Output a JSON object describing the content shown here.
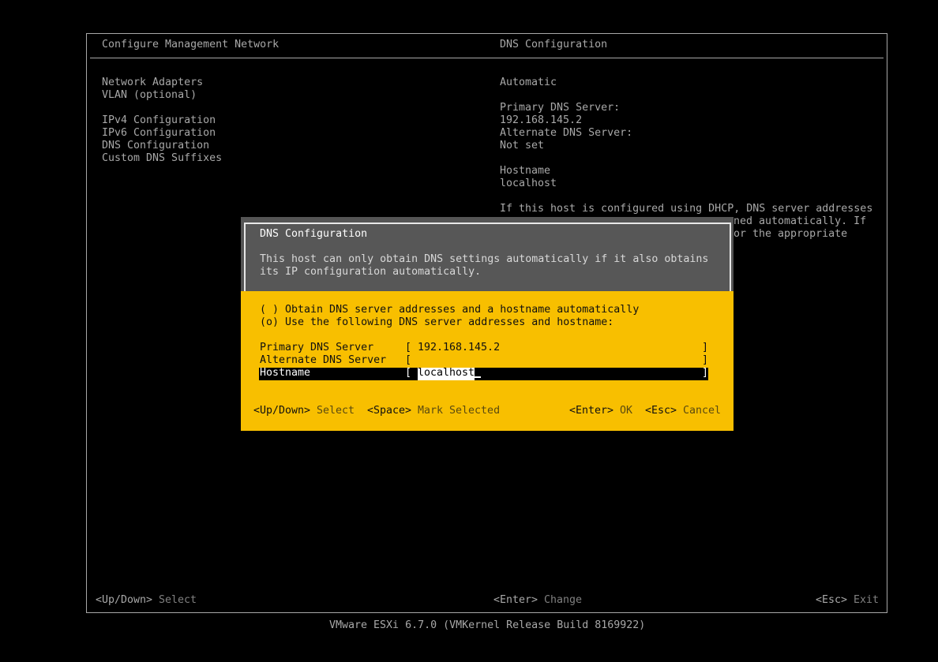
{
  "screen": {
    "title_left": "Configure Management Network",
    "title_right": "DNS Configuration"
  },
  "menu": {
    "items": [
      "Network Adapters",
      "VLAN (optional)",
      "IPv4 Configuration",
      "IPv6 Configuration",
      "DNS Configuration",
      "Custom DNS Suffixes"
    ]
  },
  "details": {
    "mode": "Automatic",
    "primary_label": "Primary DNS Server:",
    "primary_value": "192.168.145.2",
    "alternate_label": "Alternate DNS Server:",
    "alternate_value": "Not set",
    "hostname_label": "Hostname",
    "hostname_value": "localhost",
    "help_line1": "If this host is configured using DHCP, DNS server addresses",
    "help_line2": "ned automatically. If",
    "help_line3": "or the appropriate"
  },
  "dialog": {
    "title": "DNS Configuration",
    "desc_line1": "This host can only obtain DNS settings automatically if it also obtains",
    "desc_line2": "its IP configuration automatically.",
    "option_auto": "( ) Obtain DNS server addresses and a hostname automatically",
    "option_manual": "(o) Use the following DNS server addresses and hostname:",
    "fields": {
      "primary_label": "Primary DNS Server",
      "primary_value": "192.168.145.2",
      "alternate_label": "Alternate DNS Server",
      "alternate_value": "",
      "hostname_label": "Hostname",
      "hostname_value": "localhost"
    },
    "bracket_open": "[",
    "bracket_close": "]",
    "footer": {
      "updown_key": "<Up/Down>",
      "updown_action": "Select",
      "space_key": "<Space>",
      "space_action": "Mark Selected",
      "enter_key": "<Enter>",
      "enter_action": "OK",
      "esc_key": "<Esc>",
      "esc_action": "Cancel"
    }
  },
  "status_bar": {
    "updown_key": "<Up/Down>",
    "updown_action": "Select",
    "enter_key": "<Enter>",
    "enter_action": "Change",
    "esc_key": "<Esc>",
    "esc_action": "Exit"
  },
  "footer_version": "VMware ESXi 6.7.0 (VMKernel Release Build 8169922)",
  "colors": {
    "background": "#000000",
    "text": "#c0c0c0",
    "dialog_header": "#575757",
    "dialog_body": "#f8bf00",
    "highlight": "#000000"
  }
}
